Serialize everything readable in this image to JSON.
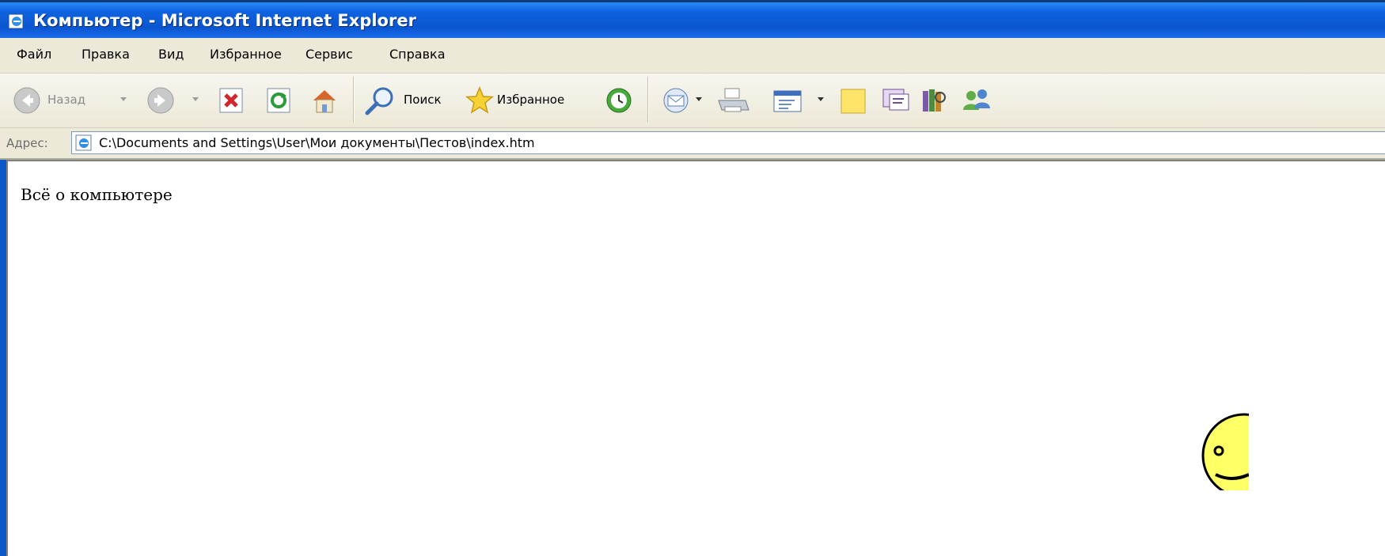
{
  "window": {
    "title": "Компьютер - Microsoft Internet Explorer"
  },
  "menu": {
    "items": [
      "Файл",
      "Правка",
      "Вид",
      "Избранное",
      "Сервис",
      "Справка"
    ]
  },
  "toolbar": {
    "back_label": "Назад",
    "search_label": "Поиск",
    "favorites_label": "Избранное"
  },
  "address": {
    "label": "Адрес:",
    "value": "C:\\Documents and Settings\\User\\Мои документы\\Пестов\\index.htm"
  },
  "page": {
    "text": "Всё о компьютере"
  },
  "colors": {
    "titlebar": "#0a55d0",
    "chrome": "#ece9d8",
    "background": "#0a3a66",
    "smiley": "#ffff66"
  },
  "icons": [
    "ie-icon",
    "back-icon",
    "forward-icon",
    "stop-icon",
    "refresh-icon",
    "home-icon",
    "search-icon",
    "favorites-icon",
    "history-icon",
    "mail-icon",
    "print-icon",
    "edit-icon",
    "notes-icon",
    "messenger-icon",
    "research-icon",
    "users-icon",
    "smiley-icon"
  ]
}
